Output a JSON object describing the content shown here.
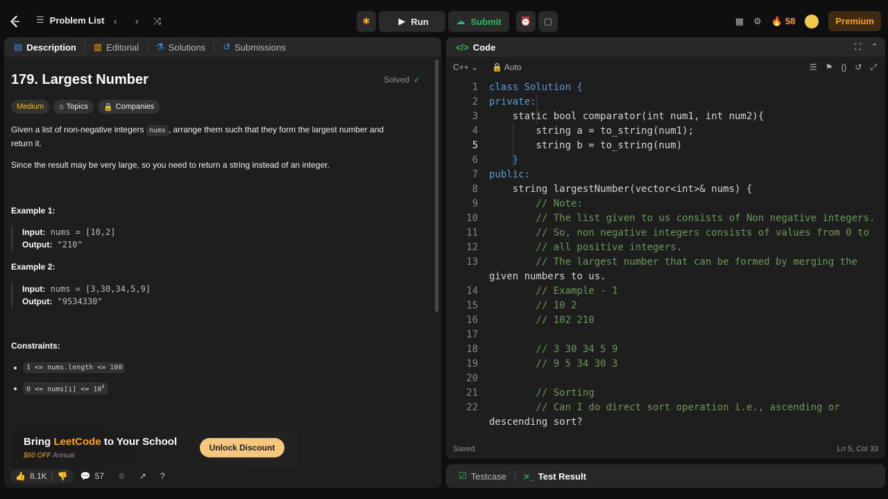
{
  "topbar": {
    "problem_list": "Problem List",
    "run": "Run",
    "submit": "Submit",
    "streak": "58",
    "premium": "Premium"
  },
  "left_tabs": [
    "Description",
    "Editorial",
    "Solutions",
    "Submissions"
  ],
  "problem": {
    "title": "179. Largest Number",
    "status": "Solved",
    "difficulty": "Medium",
    "topics": "Topics",
    "companies": "Companies",
    "desc_pre": "Given a list of non-negative integers ",
    "desc_code": "nums",
    "desc_post": ", arrange them such that they form the largest number and",
    "desc_line2": "return it.",
    "note": "Since the result may be very large, so you need to return a string instead of an integer.",
    "example1_title": "Example 1:",
    "example1_input_label": "Input:",
    "example1_input": "nums = [10,2]",
    "example1_output_label": "Output:",
    "example1_output": "\"210\"",
    "example2_title": "Example 2:",
    "example2_input_label": "Input:",
    "example2_input": "nums = [3,30,34,5,9]",
    "example2_output_label": "Output:",
    "example2_output": "\"9534330\"",
    "constraints_title": "Constraints:",
    "constraint1": "1 <= nums.length <= 100",
    "constraint2_pre": "0 <= nums[i] <= 10",
    "constraint2_sup": "9"
  },
  "promo": {
    "title_pre": "Bring ",
    "title_brand": "LeetCode",
    "title_post": " to Your School",
    "discount": "$60 OFF",
    "period": "Annual",
    "button": "Unlock Discount"
  },
  "footer": {
    "likes": "8.1K",
    "comments": "57"
  },
  "code_panel": {
    "title": "Code",
    "language": "C++",
    "mode": "Auto",
    "saved": "Saved",
    "cursor": "Ln 5, Col 33"
  },
  "code_lines": [
    {
      "n": "1",
      "t": "class Solution {"
    },
    {
      "n": "2",
      "t": "private:"
    },
    {
      "n": "3",
      "t": "    static bool comparator(int num1, int num2){"
    },
    {
      "n": "4",
      "t": "        string a = to_string(num1);"
    },
    {
      "n": "5",
      "t": "        string b = to_string(num)"
    },
    {
      "n": "6",
      "t": "    }"
    },
    {
      "n": "7",
      "t": "public:"
    },
    {
      "n": "8",
      "t": "    string largestNumber(vector<int>& nums) {"
    },
    {
      "n": "9",
      "t": "        // Note:"
    },
    {
      "n": "10",
      "t": "        // The list given to us consists of Non negative integers."
    },
    {
      "n": "11",
      "t": "        // So, non negative integers consists of values from 0 to"
    },
    {
      "n": "12",
      "t": "        // all positive integers."
    },
    {
      "n": "13",
      "t": "        // The largest number that can be formed by merging the"
    },
    {
      "n": "",
      "t": "given numbers to us."
    },
    {
      "n": "14",
      "t": "        // Example - 1"
    },
    {
      "n": "15",
      "t": "        // 10 2"
    },
    {
      "n": "16",
      "t": "        // 102 210"
    },
    {
      "n": "17",
      "t": ""
    },
    {
      "n": "18",
      "t": "        // 3 30 34 5 9"
    },
    {
      "n": "19",
      "t": "        // 9 5 34 30 3"
    },
    {
      "n": "20",
      "t": ""
    },
    {
      "n": "21",
      "t": "        // Sorting"
    },
    {
      "n": "22",
      "t": "        // Can I do direct sort operation i.e., ascending or"
    },
    {
      "n": "",
      "t": "descending sort?"
    }
  ],
  "bottom_tabs": [
    "Testcase",
    "Test Result"
  ]
}
